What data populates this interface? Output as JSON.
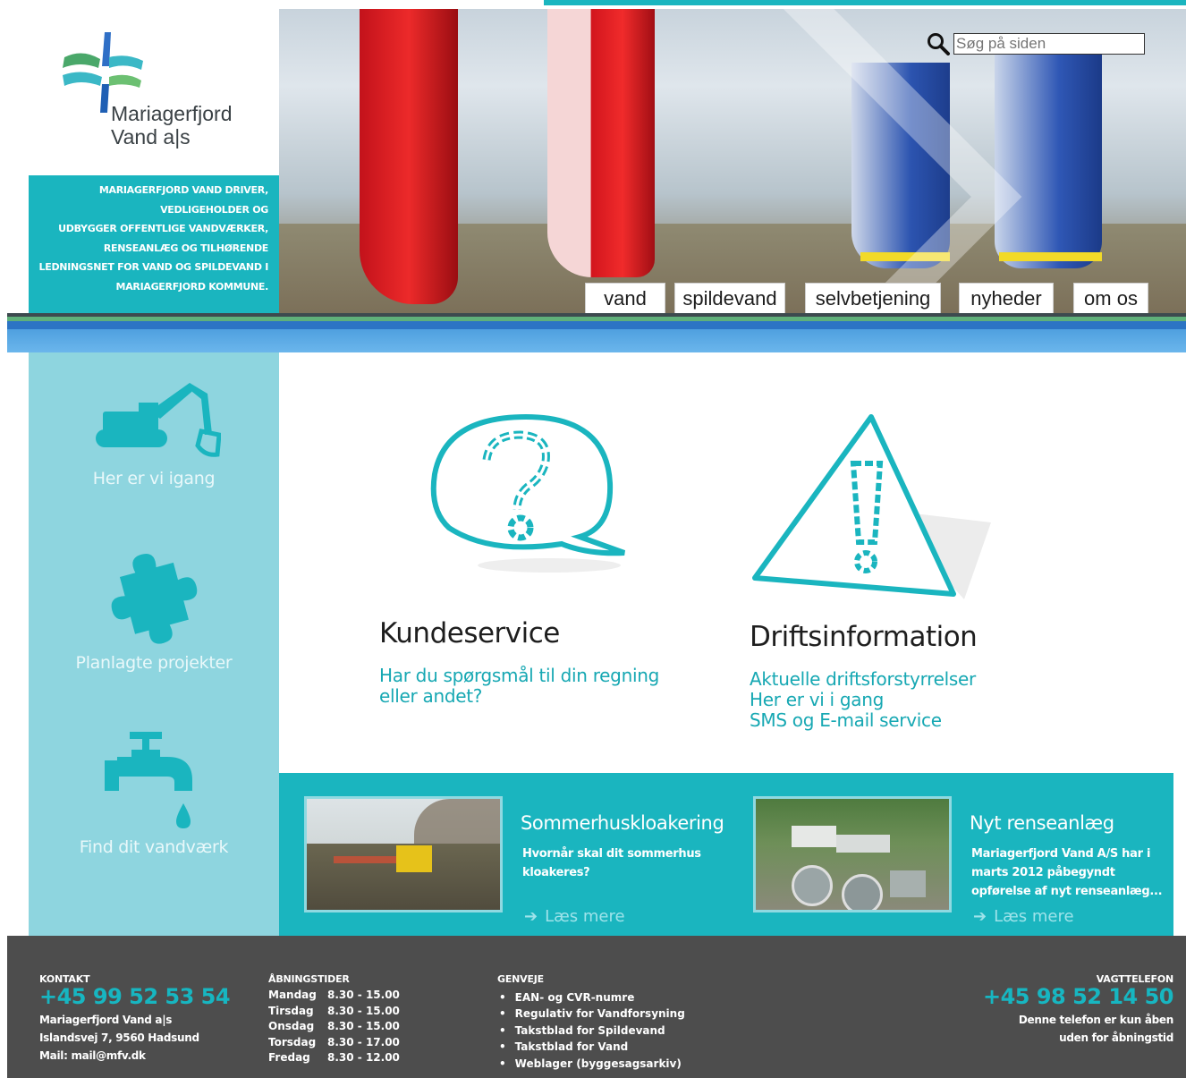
{
  "brand": {
    "name_line1": "Mariagerfjord",
    "name_line2": "Vand a|s",
    "tagline": "MARIAGERFJORD VAND DRIVER, VEDLIGEHOLDER OG UDBYGGER OFFENTLIGE VANDVÆRKER, RENSEANLÆG OG TILHØRENDE LEDNINGSNET FOR VAND OG SPILDEVAND I MARIAGERFJORD KOMMUNE.",
    "tagline_lines": [
      "MARIAGERFJORD VAND DRIVER,",
      "VEDLIGEHOLDER OG",
      "UDBYGGER OFFENTLIGE VANDVÆRKER,",
      "RENSEANLÆG OG TILHØRENDE",
      "LEDNINGSNET FOR VAND OG SPILDEVAND I",
      "MARIAGERFJORD KOMMUNE."
    ]
  },
  "search": {
    "placeholder": "Søg på siden"
  },
  "nav": {
    "tabs": [
      {
        "label": "vand"
      },
      {
        "label": "spildevand"
      },
      {
        "label": "selvbetjening"
      },
      {
        "label": "nyheder"
      },
      {
        "label": "om os"
      }
    ]
  },
  "sidebar": {
    "items": [
      {
        "label": "Her er vi igang",
        "icon": "excavator-icon"
      },
      {
        "label": "Planlagte projekter",
        "icon": "puzzle-piece-icon"
      },
      {
        "label": "Find dit vandværk",
        "icon": "water-tap-icon"
      }
    ]
  },
  "features": {
    "kundeservice": {
      "title": "Kundeservice",
      "link_line1": "Har du spørgsmål til din regning",
      "link_line2": "eller andet?",
      "icon": "question-bubble-icon"
    },
    "drift": {
      "title": "Driftsinformation",
      "links": [
        "Aktuelle driftsforstyrrelser",
        "Her er vi i gang",
        "SMS og E-mail service"
      ],
      "icon": "warning-triangle-icon"
    }
  },
  "news": [
    {
      "title": "Sommerhuskloakering",
      "text_line1": "Hvornår skal dit sommerhus",
      "text_line2": "kloakeres?",
      "more": "Læs mere"
    },
    {
      "title": "Nyt renseanlæg",
      "text_line1": "Mariagerfjord Vand A/S har i",
      "text_line2": "marts 2012 påbegyndt",
      "text_line3": "opførelse af nyt renseanlæg...",
      "more": "Læs mere"
    }
  ],
  "footer": {
    "kontakt": {
      "heading": "KONTAKT",
      "phone": "+45 99 52 53 54",
      "line1": "Mariagerfjord Vand a|s",
      "line2": "Islandsvej 7, 9560 Hadsund",
      "line3": "Mail: mail@mfv.dk"
    },
    "hours": {
      "heading": "ÅBNINGSTIDER",
      "rows": [
        {
          "day": "Mandag",
          "time": "8.30 - 15.00"
        },
        {
          "day": "Tirsdag",
          "time": "8.30 - 15.00"
        },
        {
          "day": "Onsdag",
          "time": "8.30 - 15.00"
        },
        {
          "day": "Torsdag",
          "time": "8.30 - 17.00"
        },
        {
          "day": "Fredag",
          "time": "8.30 - 12.00"
        }
      ]
    },
    "genveje": {
      "heading": "GENVEJE",
      "links": [
        "EAN- og CVR-numre",
        "Regulativ for Vandforsyning",
        "Takstblad for Spildevand",
        "Takstblad for Vand",
        "Weblager (byggesagsarkiv)"
      ]
    },
    "vagt": {
      "heading": "VAGTTELEFON",
      "phone": "+45 98 52 14 50",
      "line1": "Denne telefon er kun åben",
      "line2": "uden for åbningstid"
    }
  },
  "colors": {
    "teal": "#1ab5bf",
    "light_teal": "#8ed5df",
    "footer_bg": "#4d4d4d",
    "text_dark": "#1e1e1e"
  }
}
